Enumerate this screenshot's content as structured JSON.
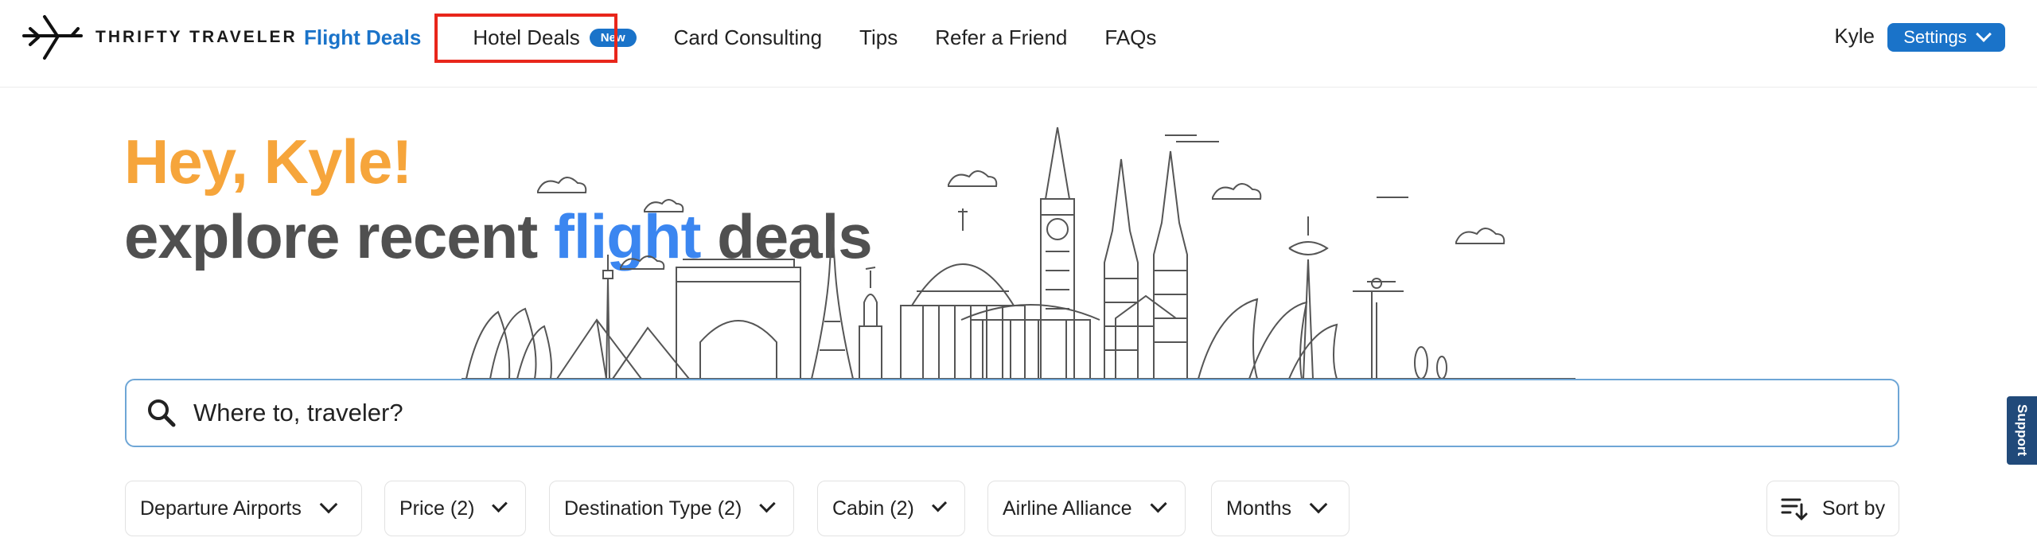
{
  "header": {
    "logo_text": "THRIFTY TRAVELER",
    "nav": {
      "flight_deals": "Flight Deals",
      "hotel_deals": "Hotel Deals",
      "hotel_badge": "New",
      "card_consulting": "Card Consulting",
      "tips": "Tips",
      "refer": "Refer a Friend",
      "faqs": "FAQs"
    },
    "user_name": "Kyle",
    "settings_label": "Settings"
  },
  "hero": {
    "greeting": "Hey, Kyle!",
    "explore_prefix": "explore recent ",
    "explore_highlight": "flight",
    "explore_suffix": " deals"
  },
  "search": {
    "placeholder": "Where to, traveler?"
  },
  "filters": {
    "departure": "Departure Airports",
    "price": "Price (2)",
    "destination": "Destination Type (2)",
    "cabin": "Cabin (2)",
    "alliance": "Airline Alliance",
    "months": "Months"
  },
  "sort_label": "Sort by",
  "support_label": "Support",
  "colors": {
    "accent_blue": "#1a73c9",
    "greeting_orange": "#f6a53b",
    "highlight_blue": "#3b86f0",
    "annotation_red": "#e8261b",
    "support_navy": "#214a7a"
  }
}
